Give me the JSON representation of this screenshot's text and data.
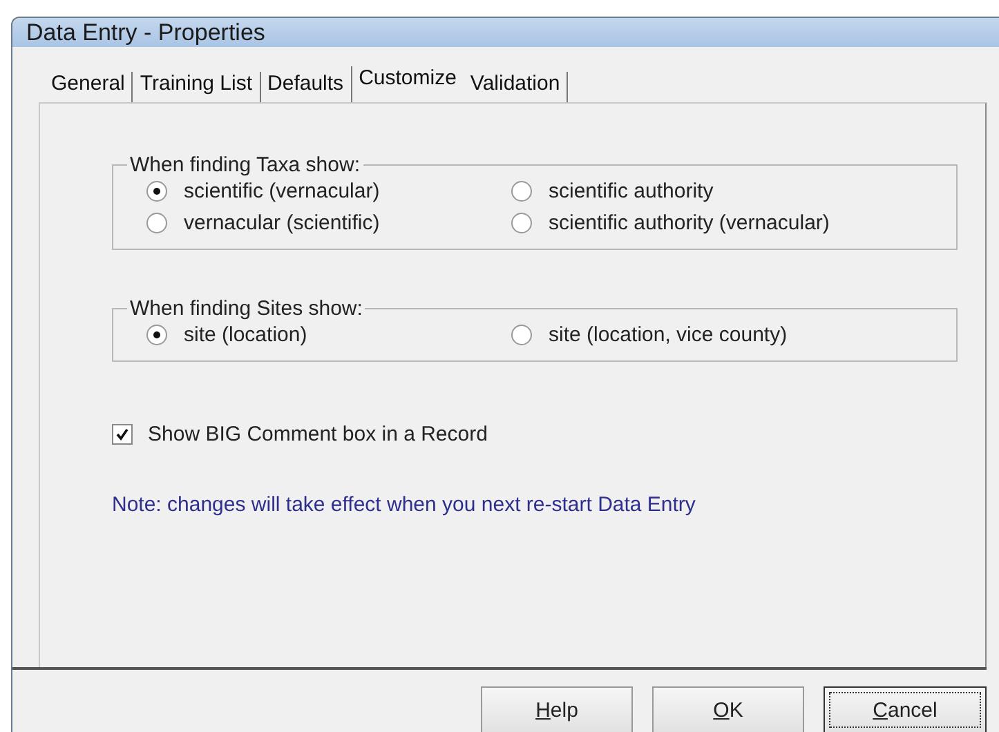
{
  "window": {
    "title": "Data Entry - Properties"
  },
  "tabs": [
    {
      "label": "General",
      "selected": false
    },
    {
      "label": "Training List",
      "selected": false
    },
    {
      "label": "Defaults",
      "selected": false
    },
    {
      "label": "Customize",
      "selected": true
    },
    {
      "label": "Validation",
      "selected": false
    }
  ],
  "groups": [
    {
      "legend": "When finding Taxa show:",
      "options": [
        {
          "label": "scientific (vernacular)",
          "selected": true
        },
        {
          "label": "scientific authority",
          "selected": false
        },
        {
          "label": "vernacular (scientific)",
          "selected": false
        },
        {
          "label": "scientific authority (vernacular)",
          "selected": false
        }
      ]
    },
    {
      "legend": "When finding Sites show:",
      "options": [
        {
          "label": "site (location)",
          "selected": true
        },
        {
          "label": "site (location, vice county)",
          "selected": false
        }
      ]
    }
  ],
  "checkbox": {
    "label": "Show BIG Comment box in a Record",
    "checked": true
  },
  "note": "Note: changes will take effect when you next re-start Data Entry",
  "buttons": [
    {
      "accel": "H",
      "rest": "elp",
      "default": false
    },
    {
      "accel": "O",
      "rest": "K",
      "default": false
    },
    {
      "accel": "C",
      "rest": "ancel",
      "default": true
    }
  ]
}
